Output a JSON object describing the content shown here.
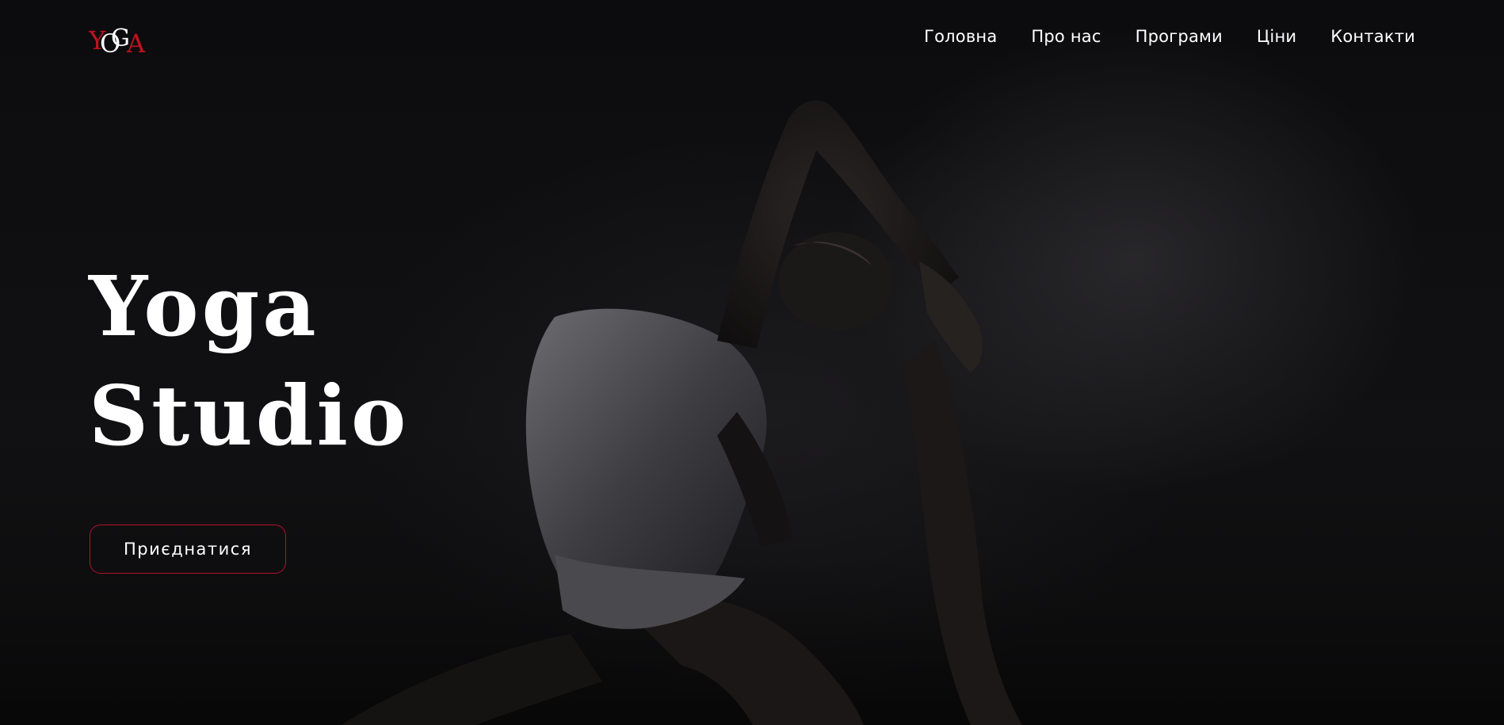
{
  "brand": {
    "logo_letters": "YOGA",
    "logo_colors": {
      "y_and_a": "#c1121f",
      "o_and_g": "#ffffff"
    }
  },
  "nav": {
    "items": [
      {
        "label": "Головна"
      },
      {
        "label": "Про нас"
      },
      {
        "label": "Програми"
      },
      {
        "label": "Ціни"
      },
      {
        "label": "Контакти"
      }
    ]
  },
  "hero": {
    "title_line1": "Yoga",
    "title_line2": "Studio",
    "cta_label": "Приєднатися",
    "accent_color": "#b2122a",
    "background": "dark photo of a woman in a backbend yoga pose (pigeon pose variant)"
  }
}
